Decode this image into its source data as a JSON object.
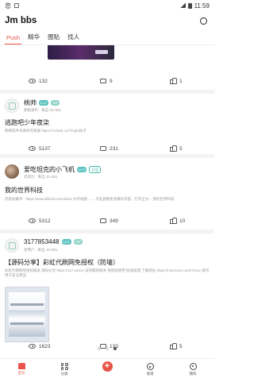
{
  "status_bar": {
    "left_text": "忠",
    "time": "11:59"
  },
  "app": {
    "title": "Jm bbs"
  },
  "tabs": [
    {
      "label": "Push",
      "active": true
    },
    {
      "label": "精华",
      "active": false
    },
    {
      "label": "图贴",
      "active": false
    },
    {
      "label": "找人",
      "active": false
    }
  ],
  "posts": [
    {
      "views": "132",
      "comments": "9",
      "likes": "1"
    },
    {
      "username": "桃帅",
      "badges": [
        "Lv.1",
        "VIP"
      ],
      "meta": "刚刚发布 · 来自 Jm bbs",
      "title": "逃跑吧少年夜柒",
      "body": "网络软件未来如何发展 https://1234ai.cn/7/ingle帖子",
      "views": "5137",
      "comments": "231",
      "likes": "5"
    },
    {
      "username": "爱吃坦克的小飞机",
      "badges": [
        "Lv.3",
        "认证"
      ],
      "meta": "老资历 · 来自 Jm bbs",
      "title": "我的世界科技",
      "body": "内容加载中 · https://www.bilibili.com/video/ 分享视频 ...... 点击查看更多精彩内容。打开全文... 我的世界科技",
      "views": "5312",
      "comments": "349",
      "likes": "10"
    },
    {
      "username": "3177853448",
      "badges": [
        "Lv.1",
        "VIP"
      ],
      "meta": "老用户 · 来自 Jm bbs",
      "title": "【源码分享】彩虹代刷网免授权（防墙）",
      "body": "彩虹代刷网免授权版本 源码分享 https://117.xx/xxx 支持最新版本 免授权使用 防墙处理 下载地址 https://t.lanzous.com/i7xxxx 请勿用于非法用途",
      "views": "1623",
      "comments": "133",
      "likes": "5"
    }
  ],
  "pager": {
    "count": 3,
    "active_index": 2
  },
  "bottom_nav": [
    {
      "label": "首页",
      "icon": "home-icon",
      "active": true
    },
    {
      "label": "分类",
      "icon": "grid-icon",
      "active": false
    },
    {
      "label": "",
      "icon": "add-icon",
      "active": false
    },
    {
      "label": "发现",
      "icon": "compass-icon",
      "active": false
    },
    {
      "label": "我的",
      "icon": "user-icon",
      "active": false
    }
  ],
  "colors": {
    "accent": "#e8544a",
    "badge": "#5cc2c0",
    "divider": "#f3f3f3"
  }
}
